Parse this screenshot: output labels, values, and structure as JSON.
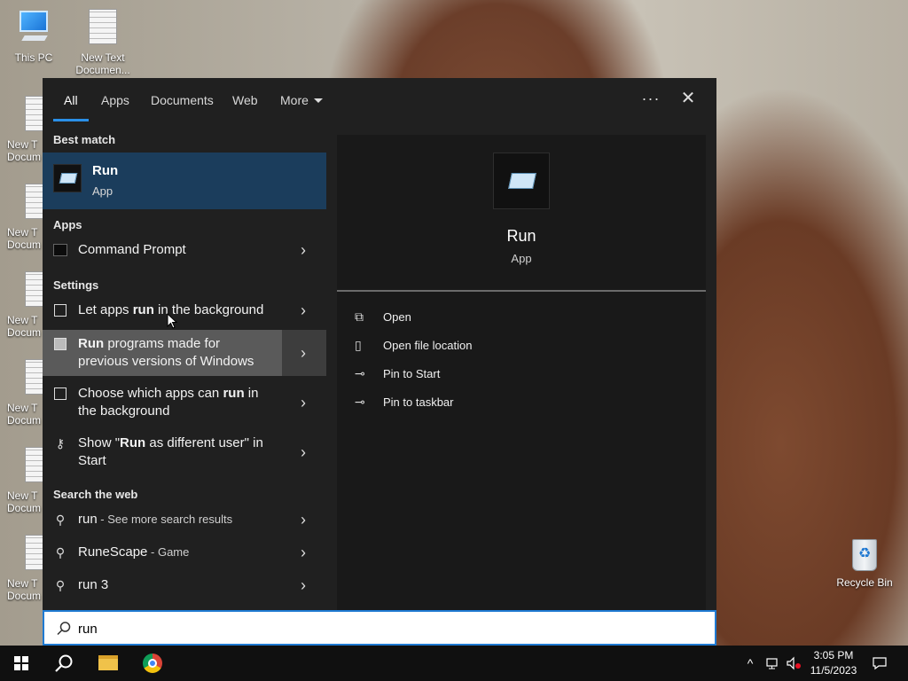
{
  "desktop": {
    "icons": [
      {
        "label": "This PC"
      },
      {
        "label": "New Text Documen..."
      },
      {
        "label": "New T Docum"
      },
      {
        "label": "New T Docum"
      },
      {
        "label": "New T Docum"
      },
      {
        "label": "New T Docum"
      },
      {
        "label": "New T Docum"
      },
      {
        "label": "New T Docum"
      }
    ],
    "recycle_bin": "Recycle Bin"
  },
  "search": {
    "tabs": [
      {
        "label": "All",
        "active": true
      },
      {
        "label": "Apps"
      },
      {
        "label": "Documents"
      },
      {
        "label": "Web"
      },
      {
        "label": "More"
      }
    ],
    "options_glyph": "···",
    "close_glyph": "✕",
    "sections": {
      "best_match": "Best match",
      "apps": "Apps",
      "settings": "Settings",
      "web": "Search the web"
    },
    "best_match": {
      "title": "Run",
      "subtitle": "App"
    },
    "apps": [
      {
        "label": "Command Prompt"
      }
    ],
    "settings": [
      {
        "pre": "Let apps ",
        "bold": "run",
        "post": " in the background"
      },
      {
        "pre": "",
        "bold": "Run",
        "post": " programs made for previous versions of Windows"
      },
      {
        "pre": "Choose which apps can ",
        "bold": "run",
        "post": " in the background"
      },
      {
        "pre": "Show \"",
        "bold": "Run",
        "post": " as different user\" in Start"
      }
    ],
    "web": [
      {
        "main": "run",
        "sub": " - See more search results"
      },
      {
        "main": "RuneScape",
        "sub": " - Game"
      },
      {
        "main": "run 3",
        "sub": ""
      }
    ],
    "detail": {
      "title": "Run",
      "subtitle": "App",
      "actions": [
        {
          "label": "Open",
          "icon": "open-icon"
        },
        {
          "label": "Open file location",
          "icon": "file-location-icon"
        },
        {
          "label": "Pin to Start",
          "icon": "pin-icon"
        },
        {
          "label": "Pin to taskbar",
          "icon": "pin-icon"
        }
      ]
    },
    "query": "run"
  },
  "taskbar": {
    "tray_up": "^",
    "time": "3:05 PM",
    "date": "11/5/2023"
  },
  "colors": {
    "accent": "#1f7ad2",
    "panel": "#202020",
    "selection": "#1b3d5c"
  }
}
